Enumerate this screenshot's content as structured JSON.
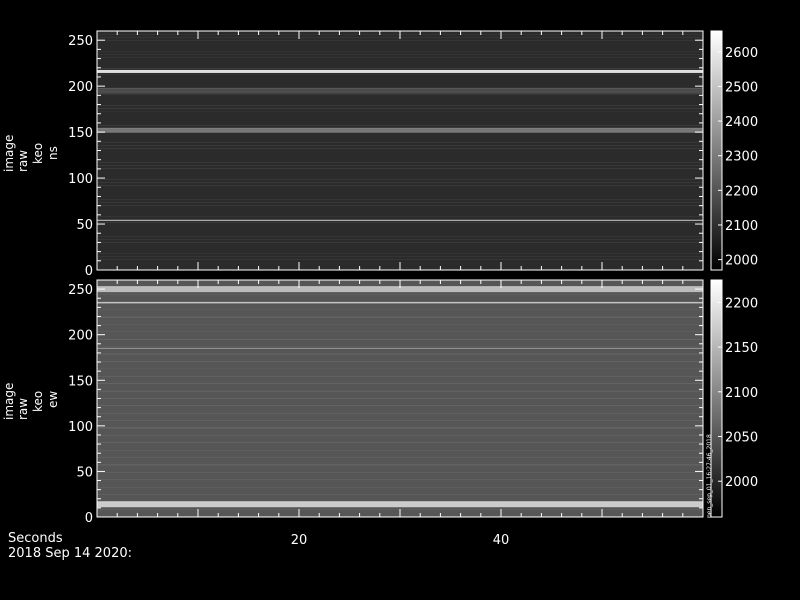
{
  "chart_data": [
    {
      "type": "heatmap",
      "panel": "top",
      "ylabel_lines": [
        "image",
        "raw",
        "keo",
        "ns"
      ],
      "ylim": [
        0,
        260
      ],
      "xlim": [
        0,
        60
      ],
      "y_ticks": [
        0,
        50,
        100,
        150,
        200,
        250
      ],
      "colorbar": {
        "range": [
          1970,
          2660
        ],
        "ticks": [
          2000,
          2100,
          2200,
          2300,
          2400,
          2500,
          2600
        ]
      },
      "bands": [
        {
          "y": 216,
          "intensity": 0.85,
          "width": 3
        },
        {
          "y": 152,
          "intensity": 0.35,
          "width": 5
        },
        {
          "y": 54,
          "intensity": 0.7,
          "width": 1
        },
        {
          "y": 195,
          "intensity": 0.15,
          "width": 6
        }
      ]
    },
    {
      "type": "heatmap",
      "panel": "bottom",
      "ylabel_lines": [
        "image",
        "raw",
        "keo",
        "ew"
      ],
      "ylim": [
        0,
        260
      ],
      "xlim": [
        0,
        60
      ],
      "y_ticks": [
        0,
        50,
        100,
        150,
        200,
        250
      ],
      "colorbar": {
        "range": [
          1960,
          2225
        ],
        "ticks": [
          2000,
          2050,
          2100,
          2150,
          2200
        ]
      },
      "bands": [
        {
          "y": 235,
          "intensity": 0.9,
          "width": 1
        },
        {
          "y": 250,
          "intensity": 0.6,
          "width": 6
        },
        {
          "y": 14,
          "intensity": 0.7,
          "width": 6
        },
        {
          "y": 185,
          "intensity": 0.4,
          "width": 1
        }
      ],
      "stamp": "pen_sep_01_16:27:46_2018"
    }
  ],
  "x_axis": {
    "label": "Seconds",
    "ticks": [
      20,
      40
    ],
    "date": "2018 Sep 14 2020:"
  }
}
